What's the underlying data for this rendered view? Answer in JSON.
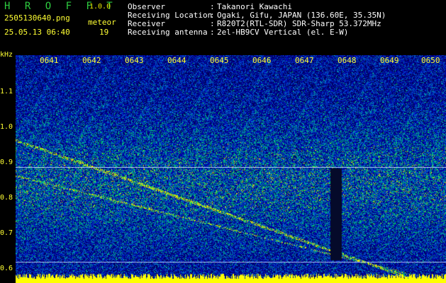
{
  "app": {
    "name": "H R O F F T",
    "version": "1.0.0"
  },
  "file": {
    "name": "2505130640.png",
    "datetime": "25.05.13 06:40"
  },
  "meteor": {
    "label": "meteor",
    "count": "19"
  },
  "info": {
    "labels": [
      "Observer",
      "Receiving Location",
      "Receiver",
      "Receiving antenna"
    ],
    "values": [
      "Takanori Kawachi",
      "Ogaki, Gifu, JAPAN (136.60E, 35.35N)",
      "R820T2(RTL-SDR) SDR-Sharp 53.372MHz",
      "2el-HB9CV Vertical (el. E-W)"
    ]
  },
  "y_axis": {
    "unit": "kHz",
    "ticks": [
      "1.1",
      "1.0",
      "0.9",
      "0.8",
      "0.7",
      "0.6"
    ]
  },
  "x_axis": {
    "ticks": [
      "0641",
      "0642",
      "0643",
      "0644",
      "0645",
      "0646",
      "0647",
      "0648",
      "0649",
      "0650"
    ]
  }
}
